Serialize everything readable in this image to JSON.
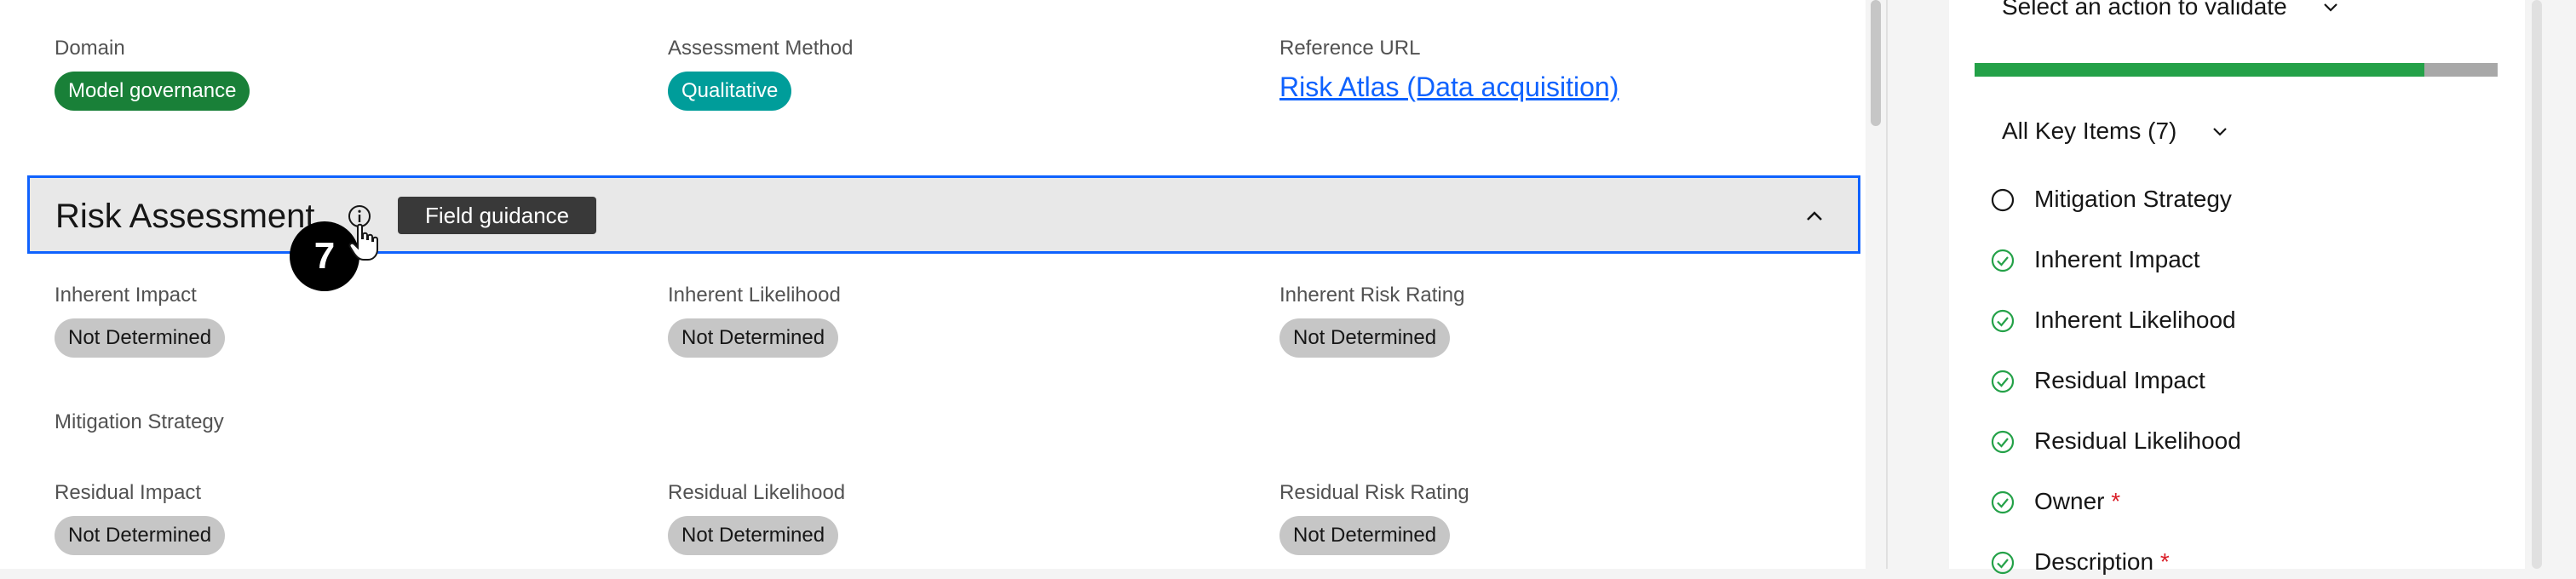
{
  "overview": {
    "domain": {
      "label": "Domain",
      "tag": "Model governance"
    },
    "assessment_method": {
      "label": "Assessment Method",
      "tag": "Qualitative"
    },
    "reference_url": {
      "label": "Reference URL",
      "link": "Risk Atlas (Data acquisition)"
    }
  },
  "risk_assessment": {
    "title": "Risk Assessment",
    "tooltip": "Field guidance",
    "step_badge": "7",
    "fields": {
      "inherent_impact": {
        "label": "Inherent Impact",
        "value": "Not Determined"
      },
      "inherent_likelihood": {
        "label": "Inherent Likelihood",
        "value": "Not Determined"
      },
      "inherent_risk_rating": {
        "label": "Inherent Risk Rating",
        "value": "Not Determined"
      },
      "mitigation_strategy": {
        "label": "Mitigation Strategy"
      },
      "residual_impact": {
        "label": "Residual Impact",
        "value": "Not Determined"
      },
      "residual_likelihood": {
        "label": "Residual Likelihood",
        "value": "Not Determined"
      },
      "residual_risk_rating": {
        "label": "Residual Risk Rating",
        "value": "Not Determined"
      }
    }
  },
  "side_panel": {
    "action_select": "Select an action to validate",
    "progress_fraction": 0.86,
    "key_items_dropdown": "All Key Items (7)",
    "items": [
      {
        "label": "Mitigation Strategy",
        "status": "pending",
        "required": false
      },
      {
        "label": "Inherent Impact",
        "status": "done",
        "required": false
      },
      {
        "label": "Inherent Likelihood",
        "status": "done",
        "required": false
      },
      {
        "label": "Residual Impact",
        "status": "done",
        "required": false
      },
      {
        "label": "Residual Likelihood",
        "status": "done",
        "required": false
      },
      {
        "label": "Owner",
        "status": "done",
        "required": true
      },
      {
        "label": "Description",
        "status": "done",
        "required": true
      }
    ],
    "required_marker": "*"
  },
  "colors": {
    "accent_blue": "#0f62fe",
    "success_green": "#24a148",
    "tag_green": "#198038",
    "tag_teal": "#009d9a",
    "required_red": "#da1e28"
  }
}
